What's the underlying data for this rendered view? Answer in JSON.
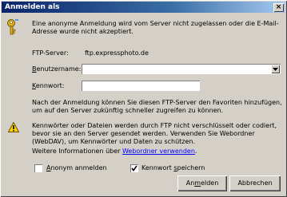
{
  "window": {
    "title": "Anmelden als",
    "close_symbol": "×"
  },
  "intro": {
    "icon": "key-icon",
    "message": "Eine anonyme Anmeldung wird vom Server nicht zugelassen oder die E-Mail-Adresse wurde nicht akzeptiert."
  },
  "form": {
    "ftp_server_label": "FTP-Server:",
    "ftp_server_value": "ftp.expressphoto.de",
    "username_label_access_key": "B",
    "username_label_rest": "enutzername:",
    "username_value": "",
    "password_label_access_key": "K",
    "password_label_rest": "ennwort:",
    "password_value": ""
  },
  "info_text": "Nach der Anmeldung können Sie diesen FTP-Server den Favoriten hinzufügen, um auf den Server zukünftig schneller zugreifen zu können.",
  "warning": {
    "icon": "warning-icon",
    "line1": "Kennwörter oder Dateien werden durch FTP nicht verschlüsselt oder codiert, bevor sie an den Server gesendet werden. Verwenden Sie Webordner (WebDAV), um Kennwörter und Daten zu schützen.",
    "more_prefix": "Weitere Informationen über ",
    "link_text": "Webordner verwenden",
    "more_suffix": "."
  },
  "options": {
    "anonymous_label_access_key": "A",
    "anonymous_label_rest": "nonym anmelden",
    "anonymous_checked": false,
    "save_pw_label_prefix": "Kennwort ",
    "save_pw_label_access_key": "s",
    "save_pw_label_rest": "peichern",
    "save_pw_checked": true
  },
  "buttons": {
    "login_prefix": "An",
    "login_access_key": "m",
    "login_rest": "elden",
    "cancel": "Abbrechen"
  },
  "colors": {
    "titlebar": "#0a246a",
    "dialog_bg": "#d4d0c8",
    "link": "#0000ff"
  }
}
